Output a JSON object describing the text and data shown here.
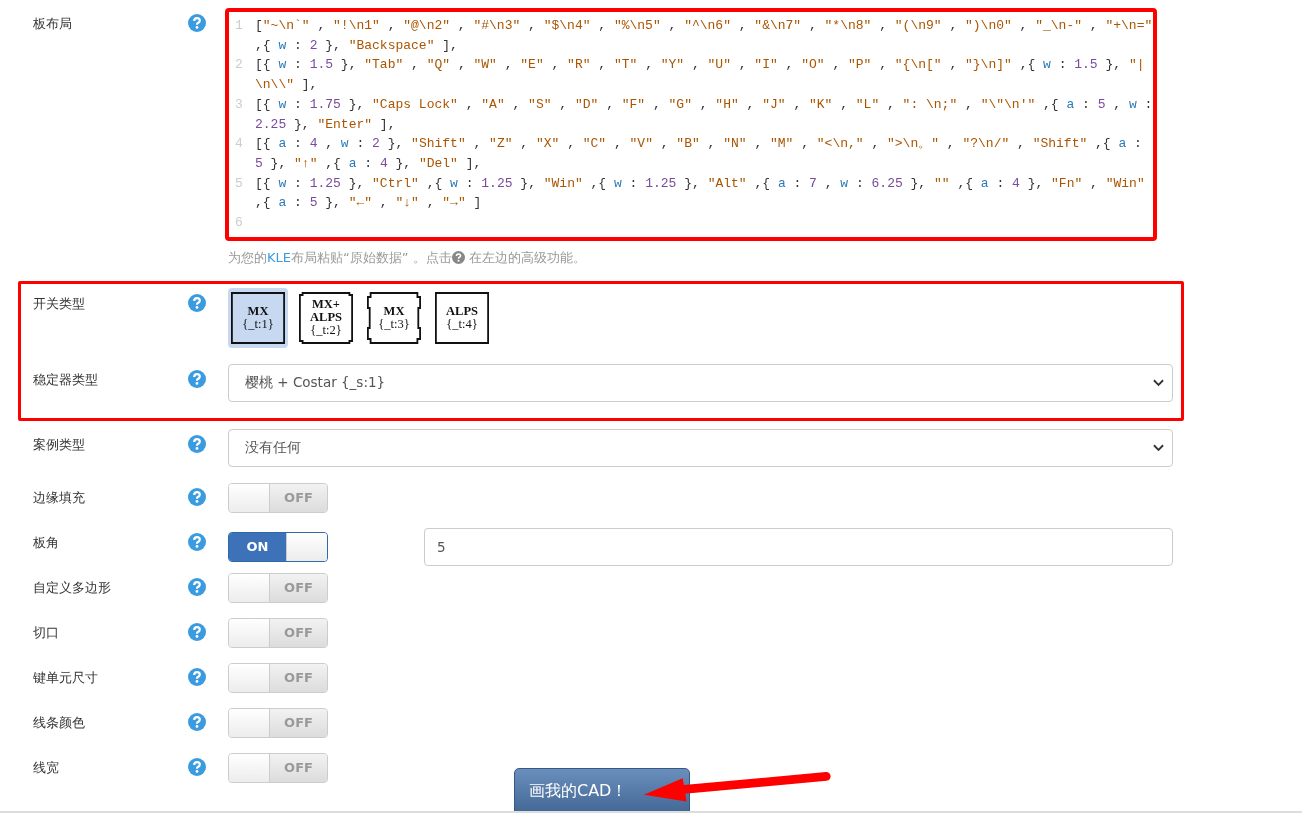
{
  "help_icons": true,
  "layout_editor": {
    "label": "板布局",
    "highlighted": true,
    "lines": [
      {
        "number": "1",
        "text": "[\"~\\n`\" , \"!\\n1\" , \"@\\n2\" , \"#\\n3\" , \"$\\n4\" , \"%\\n5\" , \"^\\n6\" , \"&\\n7\" , \"*\\n8\" , \"(\\n9\" , \")\\n0\" , \"_\\n-\" , \"+\\n=\" ,{ w : 2 }, \"Backspace\" ],"
      },
      {
        "number": "2",
        "text": "[{ w : 1.5 }, \"Tab\" , \"Q\" , \"W\" , \"E\" , \"R\" , \"T\" , \"Y\" , \"U\" , \"I\" , \"O\" , \"P\" , \"{\\n[\" , \"}\\n]\" ,{ w : 1.5 }, \"|\\n\\\\\" ],"
      },
      {
        "number": "3",
        "text": "[{ w : 1.75 }, \"Caps Lock\" , \"A\" , \"S\" , \"D\" , \"F\" , \"G\" , \"H\" , \"J\" , \"K\" , \"L\" , \": \\n;\" , \"\\\"\\n'\" ,{ a : 5 , w : 2.25 }, \"Enter\" ],"
      },
      {
        "number": "4",
        "text": "[{ a : 4 , w : 2 }, \"Shift\" , \"Z\" , \"X\" , \"C\" , \"V\" , \"B\" , \"N\" , \"M\" , \"<\\n,\" , \">\\n。\" , \"?\\n/\" , \"Shift\" ,{ a : 5 }, \"↑\" ,{ a : 4 }, \"Del\" ],"
      },
      {
        "number": "5",
        "text": "[{ w : 1.25 }, \"Ctrl\" ,{ w : 1.25 }, \"Win\" ,{ w : 1.25 }, \"Alt\" ,{ a : 7 , w : 6.25 }, \"\" ,{ a : 4 }, \"Fn\" , \"Win\" ,{ a : 5 }, \"←\" , \"↓\" , \"→\" ]"
      },
      {
        "number": "6"
      }
    ],
    "hint": {
      "before": "为您的",
      "link": "KLE",
      "middle": "布局粘贴“原始数据” 。点击",
      "after": " 在左边的高级功能。"
    }
  },
  "sections": [
    {
      "highlighted": true,
      "rows": [
        {
          "kind": "switch",
          "label": "开关类型",
          "options": [
            {
              "kind": "plain",
              "lines": [
                "MX",
                "{_t:1}"
              ],
              "selected": true
            },
            {
              "kind": "rounded",
              "lines": [
                "MX+",
                "ALPS",
                "{_t:2}"
              ],
              "selected": false
            },
            {
              "kind": "notched",
              "lines": [
                "MX",
                "{_t:3}"
              ],
              "selected": false
            },
            {
              "kind": "plain",
              "lines": [
                "ALPS",
                "{_t:4}"
              ],
              "selected": false
            }
          ]
        },
        {
          "kind": "select",
          "label": "稳定器类型",
          "value": "樱桃 + Costar {_s:1}"
        }
      ]
    },
    {
      "highlighted": false,
      "rows": [
        {
          "kind": "select",
          "label": "案例类型",
          "value": "没有任何"
        },
        {
          "kind": "toggle",
          "label": "边缘填充",
          "on": false,
          "text": "OFF"
        },
        {
          "kind": "toggle",
          "label": "板角",
          "on": true,
          "text": "ON",
          "value": "5"
        },
        {
          "kind": "toggle",
          "label": "自定义多边形",
          "on": false,
          "text": "OFF"
        },
        {
          "kind": "toggle",
          "label": "切口",
          "on": false,
          "text": "OFF"
        },
        {
          "kind": "toggle",
          "label": "键单元尺寸",
          "on": false,
          "text": "OFF"
        },
        {
          "kind": "toggle",
          "label": "线条颜色",
          "on": false,
          "text": "OFF"
        },
        {
          "kind": "toggle",
          "label": "线宽",
          "on": false,
          "text": "OFF"
        }
      ]
    }
  ],
  "submit": {
    "label": "画我的CAD！",
    "arrow": true
  }
}
